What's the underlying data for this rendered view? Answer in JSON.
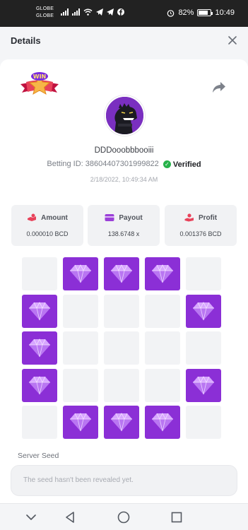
{
  "status_bar": {
    "carrier_1": "GLOBE",
    "carrier_2": "GLOBE",
    "battery": "82%",
    "time": "10:49"
  },
  "header": {
    "title": "Details",
    "close_icon": "close-icon"
  },
  "profile": {
    "badge_text": "WIN",
    "username": "DDDooobbbooiii",
    "betting_id_label": "Betting ID:",
    "betting_id": "386044073019998​22",
    "verified_label": "Verified",
    "timestamp": "2/18/2022, 10:49:34 AM"
  },
  "stats": [
    {
      "label": "Amount",
      "value": "0.000010 BCD",
      "icon": "wallet-hand-icon",
      "color": "#e8425a"
    },
    {
      "label": "Payout",
      "value": "138.6748 x",
      "icon": "card-icon",
      "color": "#9b3fd8"
    },
    {
      "label": "Profit",
      "value": "0.001376 BCD",
      "icon": "hand-coin-icon",
      "color": "#e8425a"
    }
  ],
  "grid": {
    "rows": 5,
    "cols": 5,
    "cells": [
      0,
      1,
      1,
      1,
      0,
      1,
      0,
      0,
      0,
      1,
      1,
      0,
      0,
      0,
      0,
      1,
      0,
      0,
      0,
      1,
      0,
      1,
      1,
      1,
      0
    ],
    "gem_color": "#8b2fd6",
    "empty_color": "#f2f3f5"
  },
  "server_seed": {
    "label": "Server Seed",
    "placeholder": "The seed hasn't been revealed yet."
  },
  "colors": {
    "accent_purple": "#8b2fd6",
    "verified_green": "#27b24a"
  }
}
